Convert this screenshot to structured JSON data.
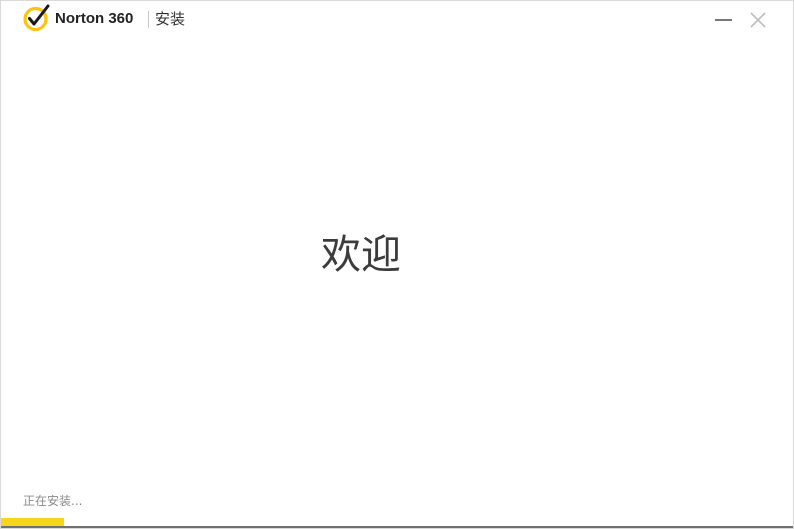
{
  "window": {
    "brand": "Norton 360",
    "title": "安装",
    "logo_icon": "norton-checkmark-logo-icon",
    "minimize_icon": "minimize-icon",
    "close_icon": "close-icon"
  },
  "main": {
    "welcome_text": "欢迎"
  },
  "footer": {
    "status_text": "正在安装...",
    "progress_fraction": 0.08
  },
  "colors": {
    "accent": "#f7d51c",
    "logo_ring": "#ffc20e",
    "text_primary": "#3c3c3c",
    "text_status": "#8a8a8a"
  }
}
